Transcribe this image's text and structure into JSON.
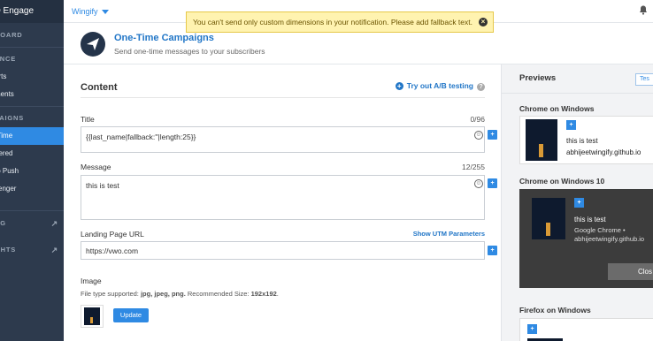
{
  "app": {
    "brand": "O Engage",
    "account": "Wingify"
  },
  "toast": {
    "message": "You can't send only custom dimensions in your notification. Please add fallback text."
  },
  "sidebar": {
    "items": [
      {
        "label": "BOARD",
        "kind": "section"
      },
      {
        "label": "ENCE",
        "kind": "section"
      },
      {
        "label": "orts",
        "kind": "item"
      },
      {
        "label": "ments",
        "kind": "item"
      },
      {
        "label": "PAIGNS",
        "kind": "section"
      },
      {
        "label": "-Time",
        "kind": "active"
      },
      {
        "label": "gered",
        "kind": "item"
      },
      {
        "label": "to Push",
        "kind": "item"
      },
      {
        "label": "senger",
        "kind": "item"
      },
      {
        "label": "NG",
        "kind": "section"
      },
      {
        "label": "GHTS",
        "kind": "section"
      }
    ]
  },
  "header": {
    "title": "One-Time Campaigns",
    "subtitle": "Send one-time messages to your subscribers"
  },
  "content": {
    "section_title": "Content",
    "ab_link": "Try out A/B testing",
    "title_label": "Title",
    "title_count": "0/96",
    "title_value": "{{last_name|fallback:''|length:25}}",
    "message_label": "Message",
    "message_count": "12/255",
    "message_value": "this is test",
    "url_label": "Landing Page URL",
    "utm_link": "Show UTM Parameters",
    "url_value": "https://vwo.com",
    "image_label": "Image",
    "file_hint_prefix": "File type supported: ",
    "file_types": "jpg, jpeg, png.",
    "size_prefix": " Recommended Size: ",
    "size_value": "192x192",
    "size_suffix": ".",
    "update_button": "Update"
  },
  "previews": {
    "title": "Previews",
    "test_button": "Tes",
    "chrome_windows": {
      "platform": "Chrome on Windows",
      "title": "this is test",
      "domain": "abhijeetwingify.github.io"
    },
    "chrome_windows10": {
      "platform": "Chrome on Windows 10",
      "title": "this is test",
      "source": "Google Chrome •",
      "domain": "abhijeetwingify.github.io",
      "close": "Clos"
    },
    "firefox_windows": {
      "platform": "Firefox on Windows"
    }
  },
  "icons": {
    "bell": "bell-icon",
    "external": "external-link-icon",
    "personalize": "personalize-icon",
    "emoji": "emoji-icon"
  },
  "colors": {
    "accent": "#2f8ae3",
    "sidebar": "#2d3a4d",
    "toast_bg": "#fff3b0"
  }
}
